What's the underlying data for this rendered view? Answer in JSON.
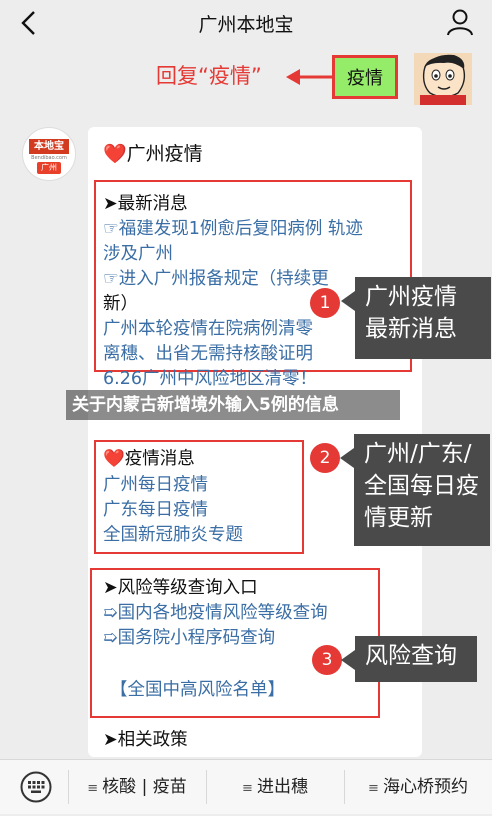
{
  "header": {
    "title": "广州本地宝"
  },
  "annotation": {
    "text": "回复“疫情”",
    "keyword": "疫情"
  },
  "card": {
    "title": "广州疫情",
    "section1": {
      "header": "➤最新消息",
      "line1": "☞福建发现1例愈后复阳病例 轨迹",
      "line2": "涉及广州",
      "line3": "☞进入广州报备规定（持续更",
      "line4": "新）",
      "line5": "广州本轮疫情在院病例清零",
      "line6": "离穗、出省无需持核酸证明",
      "line7": "6.26广州中风险地区清零！"
    },
    "section2": {
      "header": "疫情消息",
      "link1": "广州每日疫情",
      "link2": "广东每日疫情",
      "link3": "全国新冠肺炎专题"
    },
    "section3": {
      "header": "➤风险等级查询入口",
      "link1": "➯国内各地疫情风险等级查询",
      "link2": "➯国务院小程序码查询",
      "link3": "【全国中高风险名单】"
    },
    "section4": {
      "header": "➤相关政策"
    }
  },
  "callouts": [
    {
      "number": "1",
      "line1": "广州疫情",
      "line2": "最新消息"
    },
    {
      "number": "2",
      "line1": "广州/广东/",
      "line2": "全国每日疫",
      "line3": "情更新"
    },
    {
      "number": "3",
      "line1": "风险查询"
    }
  ],
  "overlay": {
    "text": "关于内蒙古新增境外输入5例的信息"
  },
  "bottom_menu": {
    "item1": "核酸 | 疫苗",
    "item2": "进出穗",
    "item3": "海心桥预约"
  },
  "logo": {
    "brand": "本地宝",
    "site": "Bendibao.com",
    "city": "广州"
  },
  "colors": {
    "accent_red": "#e53935",
    "link_blue": "#3a6ea5",
    "bubble_green": "#95ec69",
    "tip_gray": "#4a4a4a"
  }
}
